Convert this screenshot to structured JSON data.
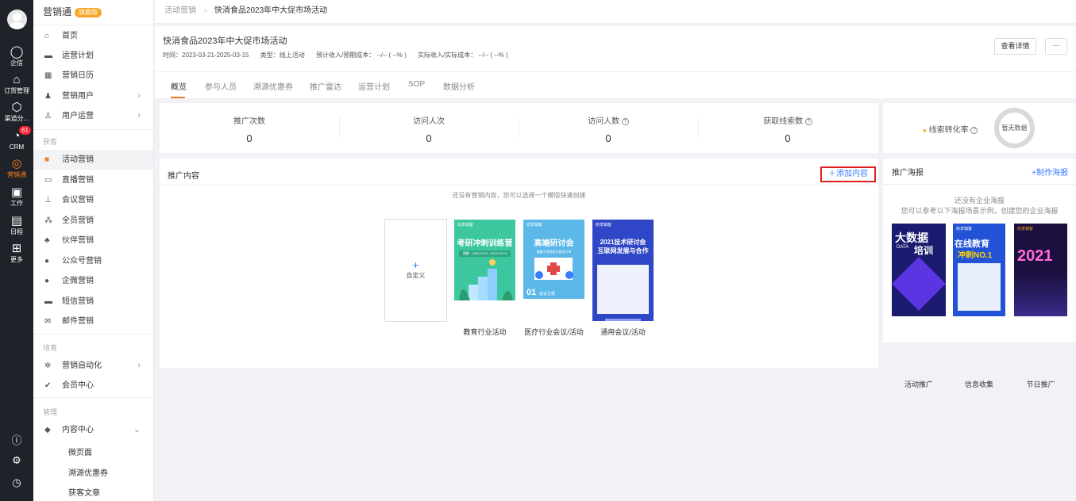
{
  "rail": {
    "items": [
      {
        "label": "企信",
        "icon": "chat-icon"
      },
      {
        "label": "订货管理",
        "icon": "bag-icon"
      },
      {
        "label": "渠道分...",
        "icon": "box-icon"
      },
      {
        "label": "CRM",
        "icon": "crm-icon",
        "badge": "61"
      },
      {
        "label": "营销通",
        "icon": "marketing-icon"
      },
      {
        "label": "工作",
        "icon": "work-icon"
      },
      {
        "label": "日程",
        "icon": "calendar-icon"
      },
      {
        "label": "更多",
        "icon": "grid-icon"
      }
    ],
    "bottom_icons": [
      "help-icon",
      "settings-icon",
      "clock-icon"
    ]
  },
  "menu": {
    "brand": "营销通",
    "vip": "旗舰版",
    "items": [
      {
        "label": "首页",
        "icon": "home-icon"
      },
      {
        "label": "运营计划",
        "icon": "plan-icon"
      },
      {
        "label": "营销日历",
        "icon": "calendar-icon"
      },
      {
        "label": "营销用户",
        "icon": "users-icon"
      },
      {
        "label": "用户运营",
        "icon": "user-ops-icon"
      }
    ],
    "section_acquire": "获客",
    "acquire_items": [
      {
        "label": "活动营销",
        "icon": "activity-icon"
      },
      {
        "label": "直播营销",
        "icon": "live-icon"
      },
      {
        "label": "会议营销",
        "icon": "meeting-icon"
      },
      {
        "label": "全员营销",
        "icon": "staff-icon"
      },
      {
        "label": "伙伴营销",
        "icon": "partner-icon"
      },
      {
        "label": "公众号营销",
        "icon": "wechat-icon"
      },
      {
        "label": "企微营销",
        "icon": "wecom-icon"
      },
      {
        "label": "短信营销",
        "icon": "sms-icon"
      },
      {
        "label": "邮件营销",
        "icon": "mail-icon"
      }
    ],
    "section_nurture": "培育",
    "nurture_items": [
      {
        "label": "营销自动化",
        "icon": "automation-icon"
      },
      {
        "label": "会员中心",
        "icon": "member-icon"
      }
    ],
    "section_manage": "管理",
    "manage_items": [
      {
        "label": "内容中心",
        "icon": "content-icon"
      }
    ],
    "sub_items": [
      "微页面",
      "溯源优惠券",
      "获客文章"
    ]
  },
  "breadcrumb": {
    "parent": "活动营销",
    "current": "快消食品2023年中大促市场活动"
  },
  "header": {
    "title": "快消食品2023年中大促市场活动",
    "meta": [
      "时间：2023-03-21-2025-03-15",
      "类型：线上活动",
      "预计收入/预期成本： --/-- ( --% )",
      "实际收入/实际成本： --/-- ( --% )"
    ],
    "detail_button": "查看详情",
    "more_button": "···"
  },
  "tabs": [
    "概览",
    "参与人员",
    "溯源优惠券",
    "推广雷达",
    "运营计划",
    "SOP",
    "数据分析"
  ],
  "stats": [
    {
      "label": "推广次数",
      "value": "0",
      "help": false
    },
    {
      "label": "访问人次",
      "value": "0",
      "help": false
    },
    {
      "label": "访问人数",
      "value": "0",
      "help": true
    },
    {
      "label": "获取线索数",
      "value": "0",
      "help": true
    }
  ],
  "conversion": {
    "label": "线索转化率",
    "no_data": "暂无数据"
  },
  "content_panel": {
    "title": "推广内容",
    "add_label": "添加内容",
    "empty_text": "还没有营销内容，您可以选择一个模版快速创建",
    "custom_label": "自定义",
    "templates": [
      {
        "caption": "教育行业活动",
        "color": "#3cc79e",
        "brand": "纷享销客",
        "heading": "考研冲刺训练营",
        "sub": "限额 · 2023.10.01 - 2023.10.15"
      },
      {
        "caption": "医疗行业会议/活动",
        "color": "#5bb8e8",
        "brand": "纷享销客",
        "heading": "高端研讨会",
        "sub": "健康大讲堂医疗前沿分享",
        "number": "01",
        "number_text": "会议主题"
      },
      {
        "caption": "通用会议/活动",
        "color": "#2f46c6",
        "brand": "纷享销客",
        "heading": "2021技术研讨会",
        "heading2": "互联网发展与合作"
      }
    ]
  },
  "poster_panel": {
    "title": "推广海报",
    "make_label": "+制作海报",
    "empty_line1": "还没有企业海报",
    "empty_line2": "您可以参考以下海报场景示例，创建您的企业海报",
    "posters": [
      {
        "caption": "活动推广",
        "main": "大数据",
        "main2": "培训",
        "tag": "DATA"
      },
      {
        "caption": "信息收集",
        "main": "在线教育",
        "main2": "冲刺NO.1",
        "tag": "纷享销客"
      },
      {
        "caption": "节日推广",
        "main": "2021",
        "tag": "纷享销客"
      }
    ]
  }
}
